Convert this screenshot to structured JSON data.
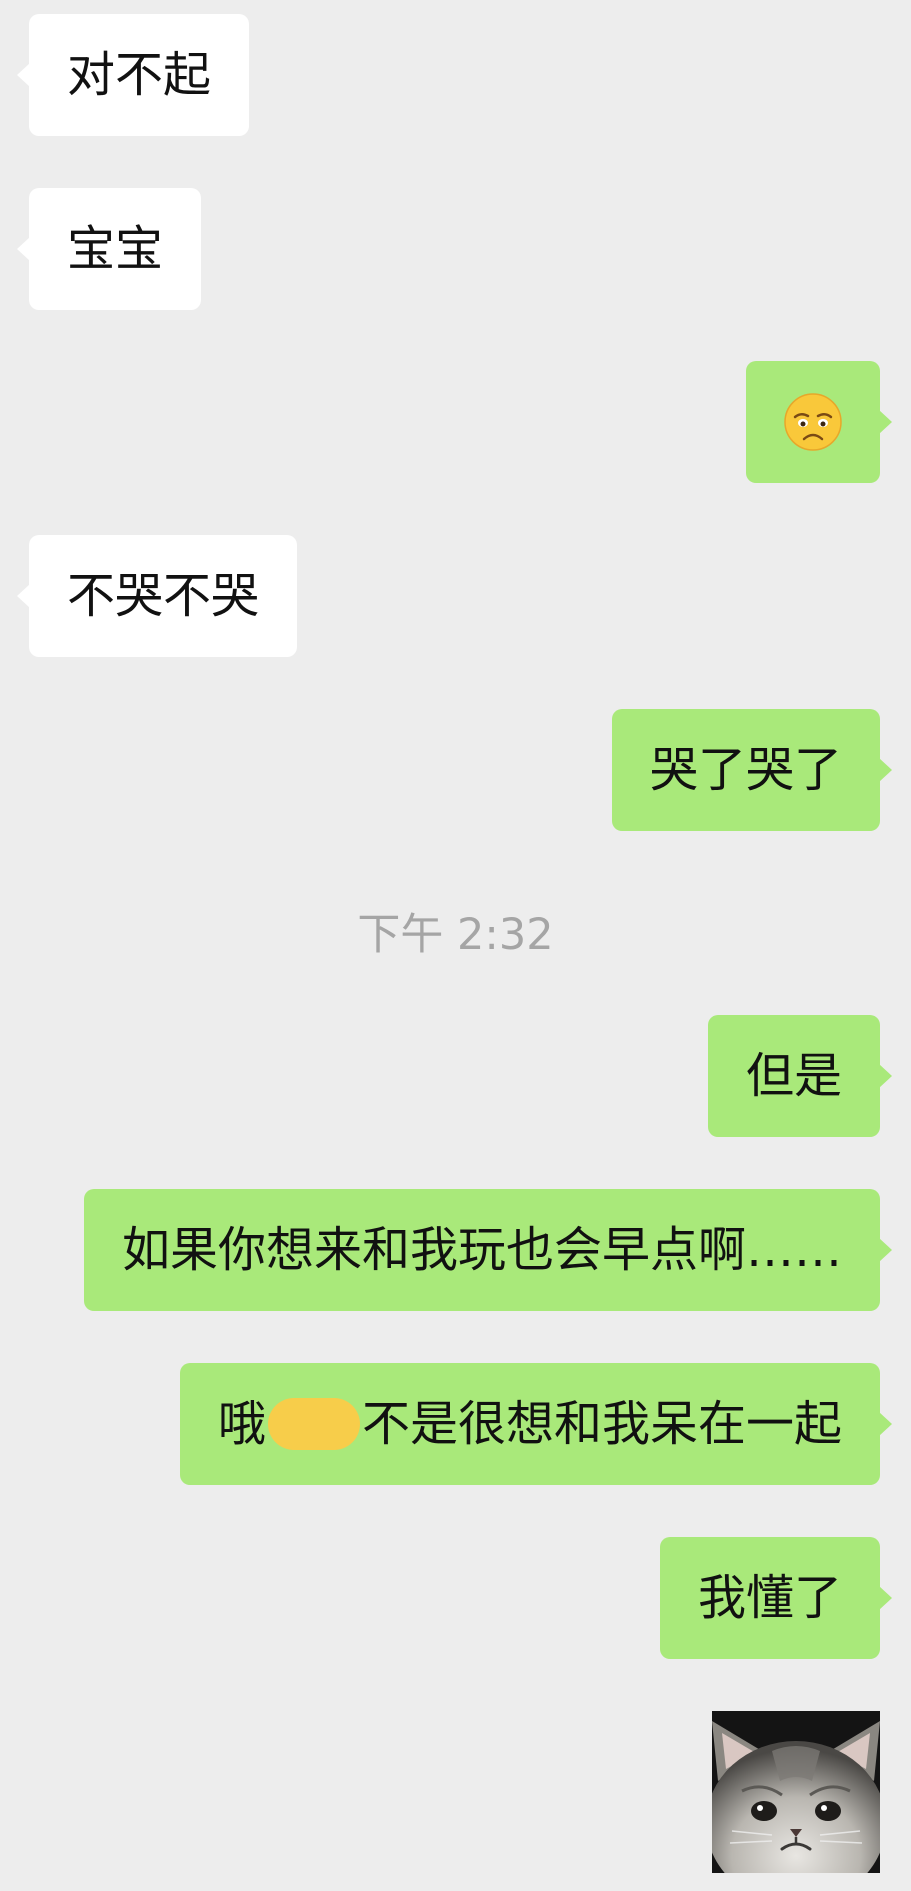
{
  "timestamp": "下午 2:32",
  "messages": [
    {
      "side": "in",
      "text": "对不起"
    },
    {
      "side": "in",
      "text": "宝宝"
    },
    {
      "side": "out",
      "emoji": "disappointed-face-emoji"
    },
    {
      "side": "in",
      "text": "不哭不哭"
    },
    {
      "side": "out",
      "text": "哭了哭了"
    },
    {
      "side": "out",
      "text": "但是"
    },
    {
      "side": "out",
      "text": "如果你想来和我玩也会早点啊……"
    },
    {
      "side": "out",
      "prefix": "哦",
      "suffix": "不是很想和我呆在一起"
    },
    {
      "side": "out",
      "text": "我懂了"
    },
    {
      "side": "out",
      "sticker": "crying-cat-sticker"
    }
  ],
  "colors": {
    "background": "#ededed",
    "incoming_bubble": "#ffffff",
    "outgoing_bubble": "#a9e97a",
    "redaction_mark": "#f7cd4a",
    "timestamp_text": "#a5a5a5"
  }
}
